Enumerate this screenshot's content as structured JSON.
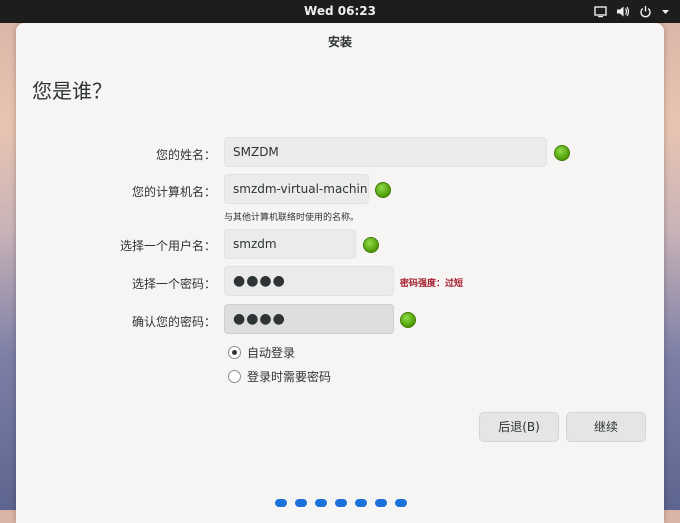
{
  "topbar": {
    "clock": "Wed 06:23",
    "icons": [
      "screen-icon",
      "volume-icon",
      "power-icon",
      "menu-arrow-icon"
    ]
  },
  "window": {
    "title": "安装",
    "heading": "您是谁？"
  },
  "form": {
    "name_label": "您的姓名：",
    "name_value": "SMZDM",
    "computer_label": "您的计算机名：",
    "computer_value": "smzdm-virtual-machine",
    "computer_hint": "与其他计算机联络时使用的名称。",
    "username_label": "选择一个用户名：",
    "username_value": "smzdm",
    "password_label": "选择一个密码：",
    "password_value": "●●●●",
    "password_strength": "密码强度：过短",
    "confirm_label": "确认您的密码：",
    "confirm_value": "●●●●",
    "auto_login": "自动登录",
    "require_password": "登录时需要密码"
  },
  "buttons": {
    "back": "后退(B)",
    "continue": "继续"
  },
  "colors": {
    "ok": "#4e9a06",
    "strength_warning": "#a51d2d",
    "pager": "#1c71d8"
  }
}
